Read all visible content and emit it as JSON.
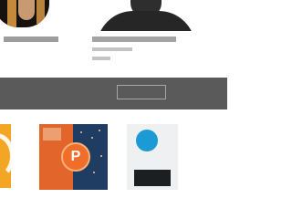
{
  "speakers": [
    {
      "name": "",
      "role": ""
    },
    {
      "name": "",
      "role": "",
      "org": ""
    }
  ],
  "cta": {
    "text": "",
    "button_label": ""
  },
  "cards": [
    {
      "title": "",
      "description": "",
      "cover_color": "#f3a624"
    },
    {
      "title": "",
      "description": "",
      "description2": "",
      "cover_letter": "P",
      "cover_colors": [
        "#e2662c",
        "#1f3d63"
      ]
    },
    {
      "title": "",
      "description": "",
      "description2": "",
      "badge_text": "",
      "cover_label": "",
      "cover_box_text": "",
      "badge_color": "#1c9ad6"
    }
  ],
  "colors": {
    "band": "#5a5a5a",
    "accent_orange": "#e8692a",
    "accent_blue": "#1c9ad6"
  }
}
